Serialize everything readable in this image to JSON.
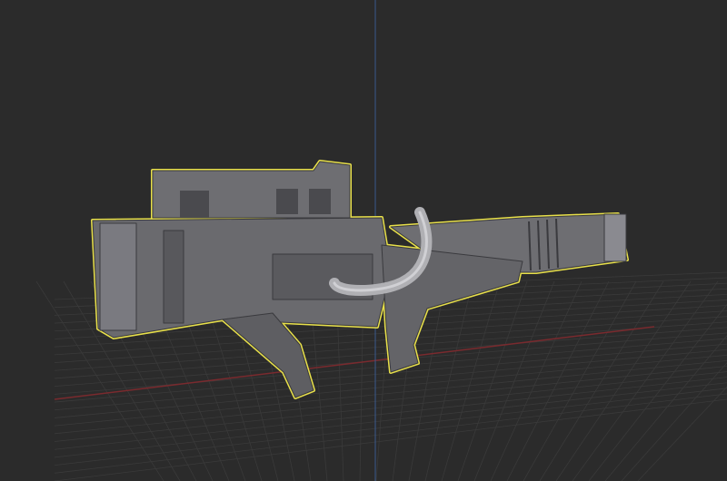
{
  "viewport": {
    "background": "#2b2b2b",
    "grid_color": "#3a3a3a",
    "x_axis_color": "#7a2a2e",
    "z_axis_color": "#3a5a8c",
    "selection_outline_color": "#e8e04a",
    "model_fill": "#6e6e72",
    "model_dark": "#4a4a4e",
    "model_light": "#9a9aa0",
    "hose_color": "#b0b0b4"
  }
}
